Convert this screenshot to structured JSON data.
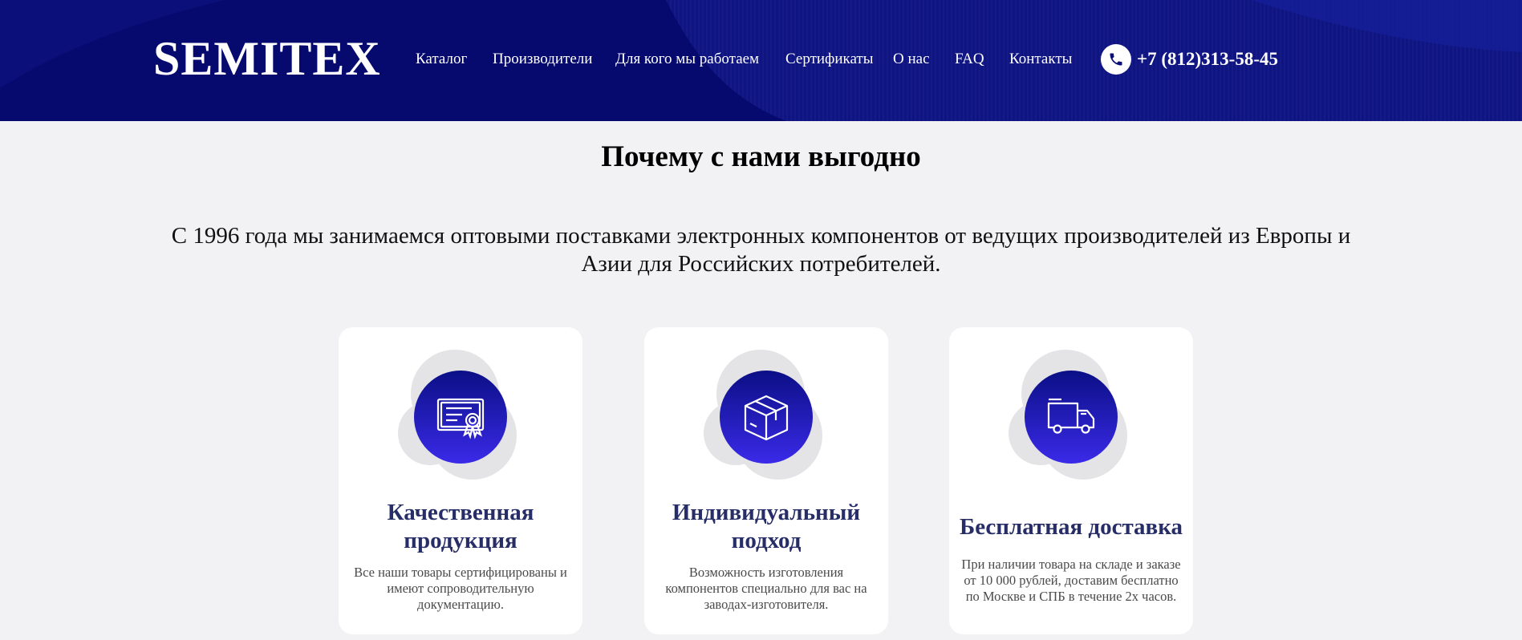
{
  "header": {
    "logo": "SEMITEX",
    "nav": [
      "Каталог",
      "Производители",
      "Для кого мы работаем",
      "Сертификаты",
      "О нас",
      "FAQ",
      "Контакты"
    ],
    "phone": "+7 (812)313-58-45",
    "phone_icon": "phone-icon"
  },
  "main": {
    "title": "Почему с нами выгодно",
    "intro": "С 1996 года мы занимаемся оптовыми поставками электронных компонентов от ведущих производителей из Европы и Азии для Российских потребителей.",
    "cards": [
      {
        "icon": "certificate-icon",
        "title": "Качественная продукция",
        "text": "Все наши товары сертифицированы и имеют сопроводительную документацию."
      },
      {
        "icon": "box-icon",
        "title": "Индивидуальный подход",
        "text": "Возможность изготовления компонентов специально для вас на заводах-изготовителя."
      },
      {
        "icon": "truck-icon",
        "title": "Бесплатная доставка",
        "text": "При наличии товара на складе и заказе от 10 000 рублей, доставим бесплатно по Москве и СПБ в течение 2х часов."
      }
    ]
  },
  "colors": {
    "header_bg": "#060a6e",
    "accent": "#2a1fd0",
    "card_title": "#272d66",
    "page_bg": "#f2f2f4"
  }
}
